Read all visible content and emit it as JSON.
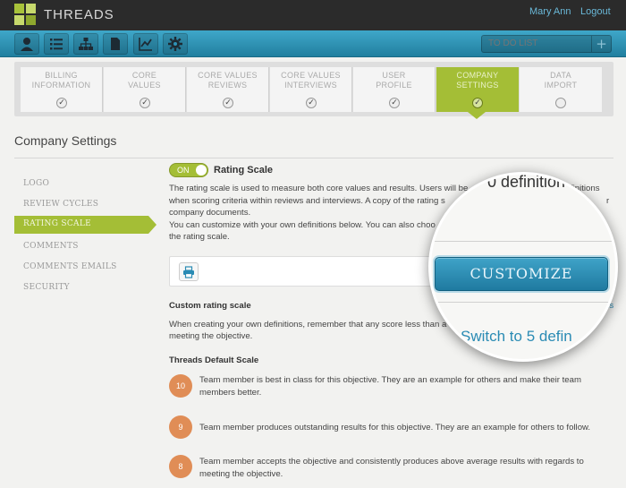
{
  "app": {
    "title": "THREADS"
  },
  "user": {
    "name": "Mary Ann",
    "logout_label": "Logout"
  },
  "toolbar": {
    "tools": [
      "user-icon",
      "list-icon",
      "org-chart-icon",
      "documents-icon",
      "chart-icon",
      "gear-icon"
    ],
    "todo_placeholder": "TO DO LIST",
    "todo_add": "+"
  },
  "steps": [
    {
      "label": "BILLING\nINFORMATION",
      "status": "complete"
    },
    {
      "label": "CORE\nVALUES",
      "status": "complete"
    },
    {
      "label": "CORE VALUES\nREVIEWS",
      "status": "complete"
    },
    {
      "label": "CORE VALUES\nINTERVIEWS",
      "status": "complete"
    },
    {
      "label": "USER\nPROFILE",
      "status": "complete"
    },
    {
      "label": "COMPANY\nSETTINGS",
      "status": "active"
    },
    {
      "label": "DATA\nIMPORT",
      "status": "incomplete"
    }
  ],
  "page_title": "Company Settings",
  "sidebar": {
    "items": [
      "LOGO",
      "REVIEW CYCLES",
      "RATING SCALE",
      "COMMENTS",
      "COMMENTS EMAILS",
      "SECURITY"
    ],
    "active": "RATING SCALE"
  },
  "rating_scale": {
    "toggle_label": "ON",
    "toggle_on": true,
    "title": "Rating Scale",
    "desc_line1": "The rating scale is used to measure both core values and results. Users will be",
    "desc_line1_tail": "finitions",
    "desc_line2": "when scoring criteria within reviews and interviews. A copy of the rating s",
    "desc_line2_tail": "r",
    "desc_line3": "company documents.",
    "desc_line4": "You can customize with your own definitions below. You can also choo",
    "desc_line5": "the rating scale.",
    "custom_heading": "Custom rating scale",
    "custom_link_cut": "ns",
    "custom_desc_line1": "When creating your own definitions, remember that any score less than a",
    "custom_desc_line2": "meeting the objective.",
    "default_heading": "Threads Default Scale",
    "scores": [
      {
        "value": "10",
        "text": "Team member is best in class for this objective. They are an example for others and make their team members better."
      },
      {
        "value": "9",
        "text": "Team member produces outstanding results for this objective. They are an example for others to follow."
      },
      {
        "value": "8",
        "text": "Team member accepts the objective and consistently produces above average results with regards to meeting the objective."
      }
    ]
  },
  "magnifier": {
    "top_text": "0 definition",
    "button_label": "CUSTOMIZE",
    "link_text": "Switch to 5 defin"
  },
  "colors": {
    "accent_green": "#a4be36",
    "accent_blue": "#2a8bb4",
    "score_orange": "#e08d56",
    "topbar": "#2b2b2b"
  }
}
